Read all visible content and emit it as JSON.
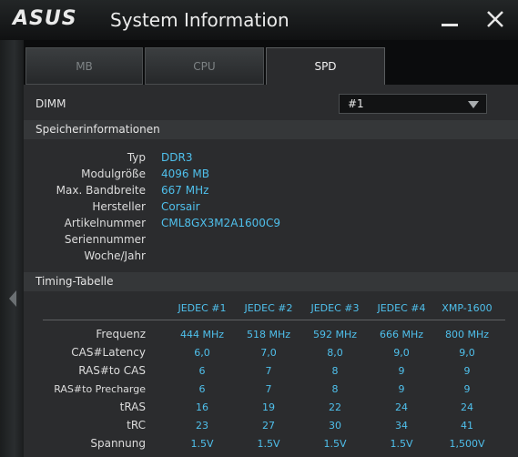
{
  "window": {
    "logo_text": "ASUS",
    "title": "System Information",
    "minimize_label": "Minimize",
    "close_label": "Close"
  },
  "tabs": [
    {
      "label": "MB",
      "active": false
    },
    {
      "label": "CPU",
      "active": false
    },
    {
      "label": "SPD",
      "active": true
    }
  ],
  "dimm": {
    "label": "DIMM",
    "selected": "#1"
  },
  "memory_info": {
    "header": "Speicherinformationen",
    "rows": [
      {
        "key": "Typ",
        "value": "DDR3"
      },
      {
        "key": "Modulgröße",
        "value": "4096 MB"
      },
      {
        "key": "Max. Bandbreite",
        "value": "667 MHz"
      },
      {
        "key": "Hersteller",
        "value": "Corsair"
      },
      {
        "key": "Artikelnummer",
        "value": "CML8GX3M2A1600C9"
      },
      {
        "key": "Seriennummer",
        "value": ""
      },
      {
        "key": "Woche/Jahr",
        "value": ""
      }
    ]
  },
  "timing": {
    "header": "Timing-Tabelle",
    "columns": [
      "JEDEC #1",
      "JEDEC #2",
      "JEDEC #3",
      "JEDEC #4",
      "XMP-1600"
    ],
    "rows": [
      {
        "key": "Frequenz",
        "values": [
          "444 MHz",
          "518 MHz",
          "592 MHz",
          "666 MHz",
          "800 MHz"
        ]
      },
      {
        "key": "CAS#Latency",
        "values": [
          "6,0",
          "7,0",
          "8,0",
          "9,0",
          "9,0"
        ]
      },
      {
        "key": "RAS#to CAS",
        "values": [
          "6",
          "7",
          "8",
          "9",
          "9"
        ]
      },
      {
        "key": "RAS#to Precharge",
        "values": [
          "6",
          "7",
          "8",
          "9",
          "9"
        ]
      },
      {
        "key": "tRAS",
        "values": [
          "16",
          "19",
          "22",
          "24",
          "24"
        ]
      },
      {
        "key": "tRC",
        "values": [
          "23",
          "27",
          "30",
          "34",
          "41"
        ]
      },
      {
        "key": "Spannung",
        "values": [
          "1.5V",
          "1.5V",
          "1.5V",
          "1.5V",
          "1,500V"
        ]
      }
    ]
  },
  "colors": {
    "accent_value": "#4fc0ec",
    "background": "#0b0c0d",
    "panel": "#2b2c2e"
  }
}
